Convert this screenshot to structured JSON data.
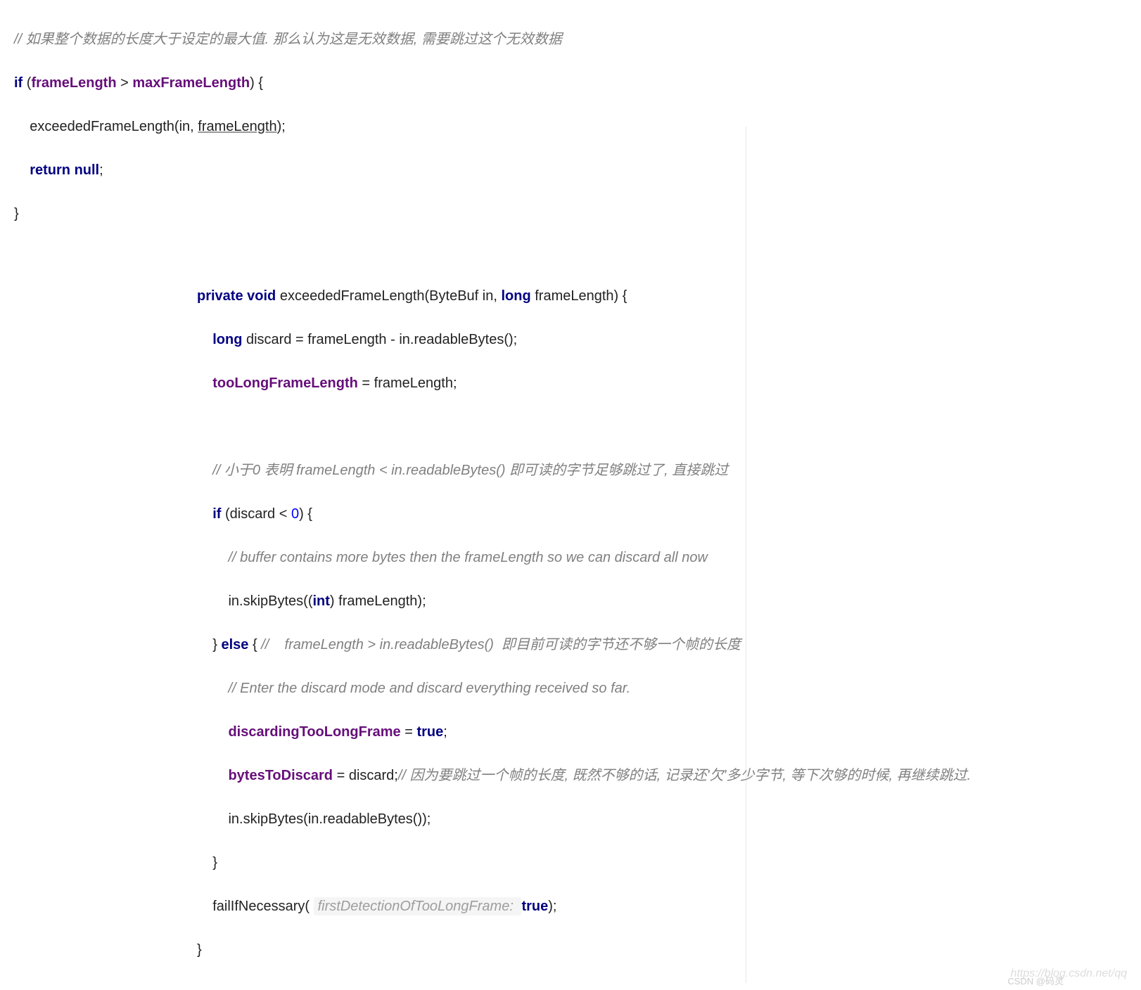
{
  "block1": {
    "comment1": "// 如果整个数据的长度大于设定的最大值. 那么认为这是无效数据, 需要跳过这个无效数据",
    "if_kw": "if",
    "lp": " (",
    "frameLength": "frameLength",
    "gt": " > ",
    "maxFrameLength": "maxFrameLength",
    "rp_brace": ") {",
    "call_prefix": "    exceededFrameLength(in, ",
    "call_arg2": "frameLength",
    "call_suffix": ");",
    "return_kw": "    return null",
    "return_semi": ";",
    "close_brace": "}"
  },
  "block2": {
    "sig_private": "private void",
    "sig_name": " exceededFrameLength(ByteBuf in, ",
    "sig_long": "long",
    "sig_rest": " frameLength) {",
    "l2_long": "    long",
    "l2_rest": " discard = frameLength - in.readableBytes();",
    "l3_field": "    tooLongFrameLength",
    "l3_rest": " = frameLength;",
    "blank": " ",
    "l5_comment": "    // 小于0 表明 frameLength < in.readableBytes() 即可读的字节足够跳过了, 直接跳过",
    "l6_if": "    if",
    "l6_rest_a": " (discard < ",
    "l6_zero": "0",
    "l6_rest_b": ") {",
    "l7_comment": "        // buffer contains more bytes then the frameLength so we can discard all now",
    "l8_a": "        in.skipBytes((",
    "l8_int": "int",
    "l8_b": ") frameLength);",
    "l9_brace_else": "    } ",
    "l9_else": "else",
    "l9_brace2": " { ",
    "l9_comment": "//    frameLength > in.readableBytes()  即目前可读的字节还不够一个帧的长度",
    "l10_comment": "        // Enter the discard mode and discard everything received so far.",
    "l11_field": "        discardingTooLongFrame",
    "l11_eq": " = ",
    "l11_true": "true",
    "l11_semi": ";",
    "l12_field": "        bytesToDiscard",
    "l12_rest": " = discard;",
    "l12_comment": "// 因为要跳过一个帧的长度, 既然不够的话, 记录还'欠'多少字节, 等下次够的时候, 再继续跳过.",
    "l13": "        in.skipBytes(in.readableBytes());",
    "l14": "    }",
    "l15_a": "    failIfNecessary( ",
    "l15_hint": "firstDetectionOfTooLongFrame: ",
    "l15_true": "true",
    "l15_b": ");",
    "l16": "}"
  },
  "watermark1": "https://blog.csdn.net/qq",
  "watermark2": "CSDN @码灵"
}
